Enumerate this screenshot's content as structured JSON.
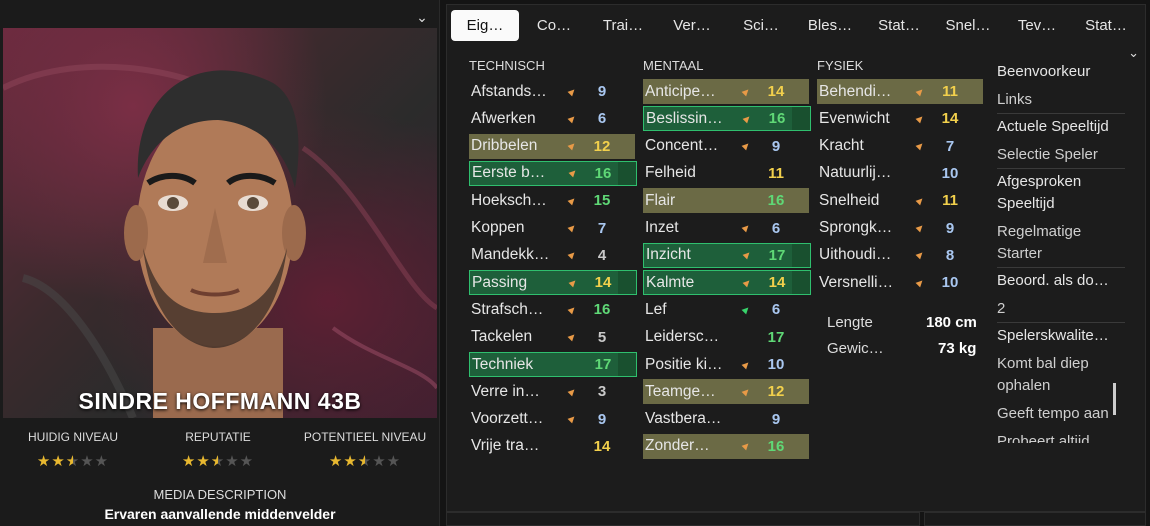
{
  "player": {
    "name": "SINDRE HOFFMANN 43B",
    "ratings": [
      {
        "label": "HUIDIG NIVEAU",
        "stars": 2.5
      },
      {
        "label": "REPUTATIE",
        "stars": 2.5
      },
      {
        "label": "POTENTIEEL NIVEAU",
        "stars": 2.5
      }
    ],
    "media_label": "MEDIA DESCRIPTION",
    "media_value": "Ervaren aanvallende middenvelder"
  },
  "tabs": [
    "Eig…",
    "Co…",
    "Trai…",
    "Ver…",
    "Sci…",
    "Bles…",
    "Stat…",
    "Snel…",
    "Tev…",
    "Stat…"
  ],
  "active_tab": 0,
  "columns": {
    "technical": {
      "header": "TECHNISCH",
      "rows": [
        {
          "name": "Afstands…",
          "value": "9",
          "icon": "up-arrow",
          "hl": ""
        },
        {
          "name": "Afwerken",
          "value": "6",
          "icon": "up-arrow",
          "hl": ""
        },
        {
          "name": "Dribbelen",
          "value": "12",
          "icon": "up-arrow",
          "hl": "gold"
        },
        {
          "name": "Eerste b…",
          "value": "16",
          "icon": "up-arrow",
          "hl": "green"
        },
        {
          "name": "Hoeksch…",
          "value": "15",
          "icon": "up-arrow",
          "hl": ""
        },
        {
          "name": "Koppen",
          "value": "7",
          "icon": "up-arrow",
          "hl": ""
        },
        {
          "name": "Mandekk…",
          "value": "4",
          "icon": "up-arrow",
          "hl": ""
        },
        {
          "name": "Passing",
          "value": "14",
          "icon": "up-arrow",
          "hl": "green"
        },
        {
          "name": "Strafsch…",
          "value": "16",
          "icon": "up-arrow",
          "hl": ""
        },
        {
          "name": "Tackelen",
          "value": "5",
          "icon": "up-arrow",
          "hl": ""
        },
        {
          "name": "Techniek",
          "value": "17",
          "icon": "none",
          "hl": "green"
        },
        {
          "name": "Verre in…",
          "value": "3",
          "icon": "up-arrow",
          "hl": ""
        },
        {
          "name": "Voorzett…",
          "value": "9",
          "icon": "up-arrow",
          "hl": ""
        },
        {
          "name": "Vrije tra…",
          "value": "14",
          "icon": "none",
          "hl": ""
        }
      ]
    },
    "mental": {
      "header": "MENTAAL",
      "rows": [
        {
          "name": "Anticipe…",
          "value": "14",
          "icon": "up-arrow",
          "hl": "gold"
        },
        {
          "name": "Beslissin…",
          "value": "16",
          "icon": "up-arrow",
          "hl": "green"
        },
        {
          "name": "Concent…",
          "value": "9",
          "icon": "up-arrow",
          "hl": ""
        },
        {
          "name": "Felheid",
          "value": "11",
          "icon": "none",
          "hl": ""
        },
        {
          "name": "Flair",
          "value": "16",
          "icon": "none",
          "hl": "gold"
        },
        {
          "name": "Inzet",
          "value": "6",
          "icon": "up-arrow",
          "hl": ""
        },
        {
          "name": "Inzicht",
          "value": "17",
          "icon": "up-arrow",
          "hl": "green"
        },
        {
          "name": "Kalmte",
          "value": "14",
          "icon": "up-arrow",
          "hl": "green"
        },
        {
          "name": "Lef",
          "value": "6",
          "icon": "up-arrow-green",
          "hl": ""
        },
        {
          "name": "Leidersc…",
          "value": "17",
          "icon": "none",
          "hl": ""
        },
        {
          "name": "Positie ki…",
          "value": "10",
          "icon": "up-arrow",
          "hl": ""
        },
        {
          "name": "Teamge…",
          "value": "12",
          "icon": "up-arrow",
          "hl": "gold"
        },
        {
          "name": "Vastbera…",
          "value": "9",
          "icon": "none",
          "hl": ""
        },
        {
          "name": "Zonder…",
          "value": "16",
          "icon": "up-arrow",
          "hl": "gold"
        }
      ]
    },
    "physical": {
      "header": "FYSIEK",
      "rows": [
        {
          "name": "Behendi…",
          "value": "11",
          "icon": "up-arrow",
          "hl": "gold"
        },
        {
          "name": "Evenwicht",
          "value": "14",
          "icon": "up-arrow",
          "hl": ""
        },
        {
          "name": "Kracht",
          "value": "7",
          "icon": "up-arrow",
          "hl": ""
        },
        {
          "name": "Natuurlij…",
          "value": "10",
          "icon": "none",
          "hl": ""
        },
        {
          "name": "Snelheid",
          "value": "11",
          "icon": "up-arrow",
          "hl": ""
        },
        {
          "name": "Sprongk…",
          "value": "9",
          "icon": "up-arrow",
          "hl": ""
        },
        {
          "name": "Uithoudi…",
          "value": "8",
          "icon": "up-arrow",
          "hl": ""
        },
        {
          "name": "Versnelli…",
          "value": "10",
          "icon": "up-arrow",
          "hl": ""
        }
      ],
      "length_label": "Lengte",
      "length_value": "180 cm",
      "weight_label": "Gewic…",
      "weight_value": "73 kg"
    }
  },
  "info": {
    "foot_label": "Beenvoorkeur",
    "foot_value": "Links",
    "playtime_label": "Actuele Speeltijd",
    "playtime_value": "Selectie Speler",
    "agreed_label": "Afgesproken Speeltijd",
    "agreed_value": "Regelmatige Starter",
    "rated_label": "Beoord. als do…",
    "rated_value": "2",
    "qualities_label": "Spelerskwalite…",
    "quality_1": "Komt bal diep ophalen",
    "quality_2": "Geeft tempo aan",
    "quality_3": "Probeert altijd"
  },
  "colors": {
    "gold_highlight": "#6b6a45",
    "green_highlight": "#1e5f3a",
    "arrow_orange": "#e89a47",
    "star": "#e8b830"
  }
}
